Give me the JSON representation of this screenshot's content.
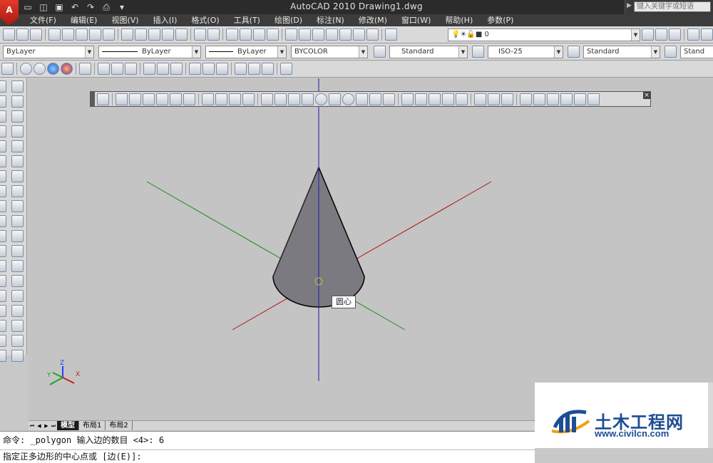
{
  "app": {
    "window_title": "AutoCAD 2010    Drawing1.dwg",
    "logo_letter": "A",
    "search_placeholder": "键入关键字或短语"
  },
  "menu": [
    "文件(F)",
    "编辑(E)",
    "视图(V)",
    "插入(I)",
    "格式(O)",
    "工具(T)",
    "绘图(D)",
    "标注(N)",
    "修改(M)",
    "窗口(W)",
    "帮助(H)",
    "参数(P)"
  ],
  "toolbar1": {
    "layer_value": "0"
  },
  "properties": {
    "color": "ByLayer",
    "linetype": "ByLayer",
    "lineweight": "ByLayer",
    "plotstyle": "BYCOLOR",
    "text_style": "Standard",
    "dim_style": "ISO-25",
    "table_style": "Standard",
    "multileader_style": "Stand"
  },
  "viewport": {
    "snap_tooltip": "圆心",
    "colors": {
      "background": "#c4c4c4",
      "z_axis": "#1e1ea8",
      "x_axis": "#b01010",
      "y_axis": "#1a8a1a",
      "cone_fill": "#7a7a80"
    },
    "ucs": {
      "x_label": "X",
      "y_label": "Y",
      "z_label": "Z"
    }
  },
  "tabs": [
    "模型",
    "布局1",
    "布局2"
  ],
  "command": {
    "history": "命令: _polygon 输入边的数目 <4>: 6",
    "prompt": "指定正多边形的中心点或 [边(E)]:"
  },
  "watermark": {
    "title": "土木工程网",
    "url": "www.civilcn.com"
  }
}
